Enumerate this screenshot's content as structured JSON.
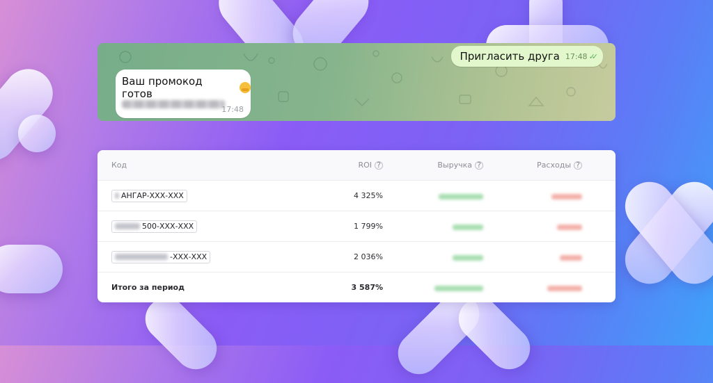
{
  "chat": {
    "outgoing": {
      "text": "Пригласить друга",
      "time": "17:48",
      "status_icon": "double-check-icon"
    },
    "incoming": {
      "text": "Ваш промокод готов",
      "emoji": "hugging-face-emoji",
      "time": "17:48"
    }
  },
  "table": {
    "headers": {
      "code": "Код",
      "roi": "ROI",
      "revenue": "Выручка",
      "expenses": "Расходы"
    },
    "rows": [
      {
        "code": "АНГАР-ХХХ-ХХХ",
        "roi": "4 325%"
      },
      {
        "code": "500-ХХХ-ХХХ",
        "roi": "1 799%"
      },
      {
        "code": "-ХХХ-ХХХ",
        "roi": "2 036%"
      }
    ],
    "total": {
      "label": "Итого за период",
      "roi": "3 587%"
    }
  },
  "colors": {
    "bubble_out": "#e2f7cb",
    "revenue_blur": "#a8deb1",
    "expense_blur": "#f3b0a9",
    "chat_bg": "#86b48c"
  }
}
